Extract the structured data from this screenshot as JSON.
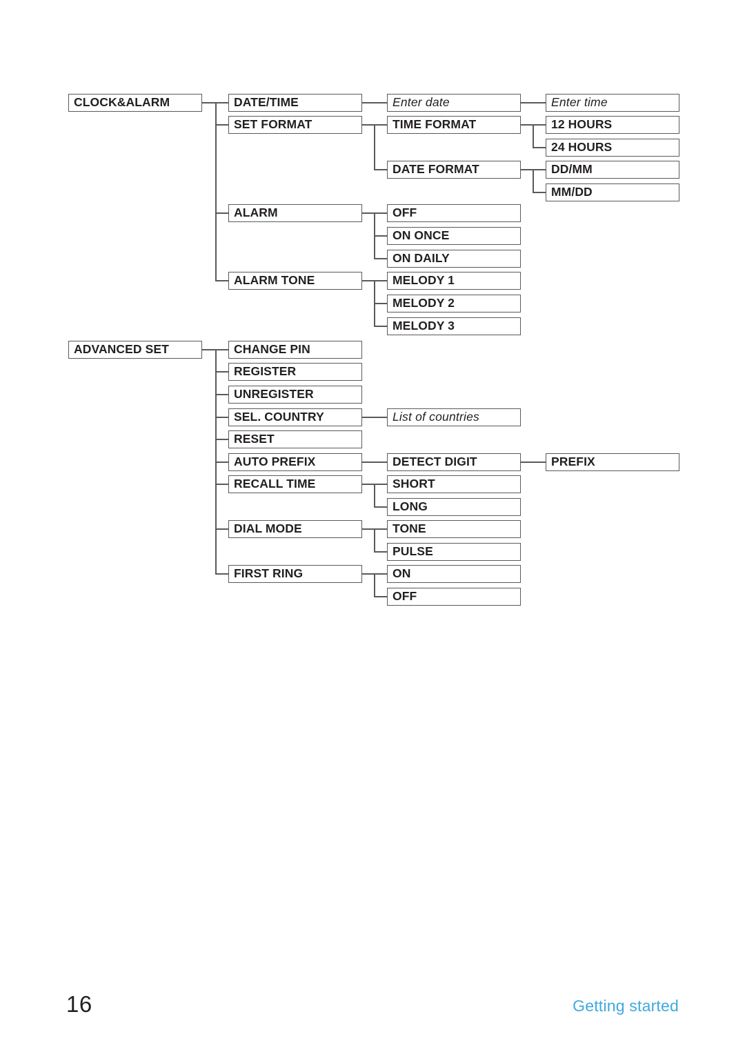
{
  "page": {
    "number": "16",
    "section_label": "Getting started",
    "accent_color": "#3fa9e0",
    "line_color": "#58595b",
    "text_color": "#231f20"
  },
  "diagram": {
    "type": "menu-tree",
    "roots": [
      {
        "id": "clock-alarm",
        "label": "CLOCK&ALARM",
        "children": [
          {
            "id": "date-time",
            "label": "DATE/TIME",
            "children": [
              {
                "id": "enter-date",
                "label": "Enter date",
                "style": "italic",
                "children": [
                  {
                    "id": "enter-time",
                    "label": "Enter time",
                    "style": "italic"
                  }
                ]
              }
            ]
          },
          {
            "id": "set-format",
            "label": "SET FORMAT",
            "children": [
              {
                "id": "time-format",
                "label": "TIME FORMAT",
                "children": [
                  {
                    "id": "12-hours",
                    "label": "12 HOURS"
                  },
                  {
                    "id": "24-hours",
                    "label": "24 HOURS"
                  }
                ]
              },
              {
                "id": "date-format",
                "label": "DATE FORMAT",
                "children": [
                  {
                    "id": "dd-mm",
                    "label": "DD/MM"
                  },
                  {
                    "id": "mm-dd",
                    "label": "MM/DD"
                  }
                ]
              }
            ]
          },
          {
            "id": "alarm",
            "label": "ALARM",
            "children": [
              {
                "id": "alarm-off",
                "label": "OFF"
              },
              {
                "id": "alarm-on-once",
                "label": "ON ONCE"
              },
              {
                "id": "alarm-on-daily",
                "label": "ON DAILY"
              }
            ]
          },
          {
            "id": "alarm-tone",
            "label": "ALARM TONE",
            "children": [
              {
                "id": "melody-1",
                "label": "MELODY 1"
              },
              {
                "id": "melody-2",
                "label": "MELODY 2"
              },
              {
                "id": "melody-3",
                "label": "MELODY 3"
              }
            ]
          }
        ]
      },
      {
        "id": "advanced-set",
        "label": "ADVANCED SET",
        "children": [
          {
            "id": "change-pin",
            "label": "CHANGE PIN"
          },
          {
            "id": "register",
            "label": "REGISTER"
          },
          {
            "id": "unregister",
            "label": "UNREGISTER"
          },
          {
            "id": "sel-country",
            "label": "SEL. COUNTRY",
            "children": [
              {
                "id": "list-of-countries",
                "label": "List of countries",
                "style": "italic"
              }
            ]
          },
          {
            "id": "reset",
            "label": "RESET"
          },
          {
            "id": "auto-prefix",
            "label": "AUTO PREFIX",
            "children": [
              {
                "id": "detect-digit",
                "label": "DETECT DIGIT",
                "children": [
                  {
                    "id": "prefix",
                    "label": "PREFIX"
                  }
                ]
              }
            ]
          },
          {
            "id": "recall-time",
            "label": "RECALL TIME",
            "children": [
              {
                "id": "recall-short",
                "label": "SHORT"
              },
              {
                "id": "recall-long",
                "label": "LONG"
              }
            ]
          },
          {
            "id": "dial-mode",
            "label": "DIAL MODE",
            "children": [
              {
                "id": "dial-tone",
                "label": "TONE"
              },
              {
                "id": "dial-pulse",
                "label": "PULSE"
              }
            ]
          },
          {
            "id": "first-ring",
            "label": "FIRST RING",
            "children": [
              {
                "id": "first-ring-on",
                "label": "ON"
              },
              {
                "id": "first-ring-off",
                "label": "OFF"
              }
            ]
          }
        ]
      }
    ]
  },
  "nodes": {
    "clock_alarm": "CLOCK&ALARM",
    "date_time": "DATE/TIME",
    "enter_date": "Enter date",
    "enter_time": "Enter time",
    "set_format": "SET FORMAT",
    "time_format": "TIME FORMAT",
    "hours_12": "12 HOURS",
    "hours_24": "24 HOURS",
    "date_format": "DATE FORMAT",
    "dd_mm": "DD/MM",
    "mm_dd": "MM/DD",
    "alarm": "ALARM",
    "alarm_off": "OFF",
    "alarm_on_once": "ON ONCE",
    "alarm_on_daily": "ON DAILY",
    "alarm_tone": "ALARM TONE",
    "melody_1": "MELODY 1",
    "melody_2": "MELODY 2",
    "melody_3": "MELODY 3",
    "advanced_set": "ADVANCED SET",
    "change_pin": "CHANGE PIN",
    "register": "REGISTER",
    "unregister": "UNREGISTER",
    "sel_country": "SEL. COUNTRY",
    "list_of_countries": "List of countries",
    "reset": "RESET",
    "auto_prefix": "AUTO PREFIX",
    "detect_digit": "DETECT DIGIT",
    "prefix": "PREFIX",
    "recall_time": "RECALL TIME",
    "recall_short": "SHORT",
    "recall_long": "LONG",
    "dial_mode": "DIAL MODE",
    "dial_tone": "TONE",
    "dial_pulse": "PULSE",
    "first_ring": "FIRST RING",
    "first_ring_on": "ON",
    "first_ring_off": "OFF"
  }
}
